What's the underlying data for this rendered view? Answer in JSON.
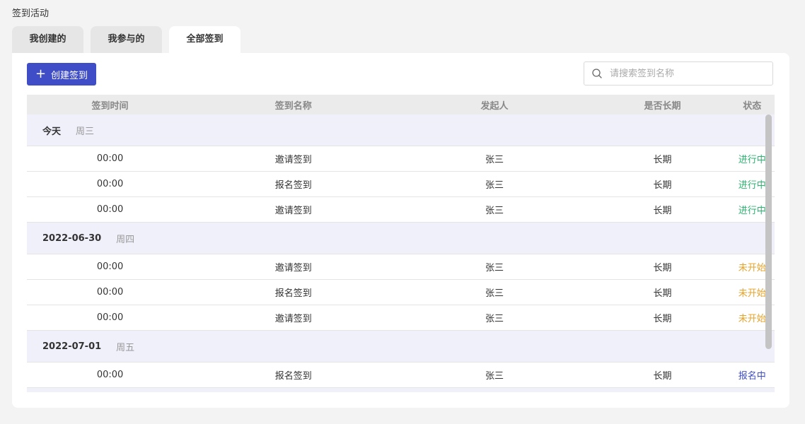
{
  "page_title": "签到活动",
  "tabs": [
    {
      "label": "我创建的",
      "active": false
    },
    {
      "label": "我参与的",
      "active": false
    },
    {
      "label": "全部签到",
      "active": true
    }
  ],
  "toolbar": {
    "create_label": "创建签到",
    "search_placeholder": "请搜索签到名称"
  },
  "colors": {
    "primary": "#3f4ec7",
    "status_in_progress": "#2bb36f",
    "status_not_started": "#e5a32a",
    "status_registering": "#3f4ec7"
  },
  "table": {
    "headers": [
      "签到时间",
      "签到名称",
      "发起人",
      "是否长期",
      "状态"
    ],
    "groups": [
      {
        "date": "今天",
        "weekday": "周三",
        "rows": [
          {
            "time": "00:00",
            "name": "邀请签到",
            "initiator": "张三",
            "long_term": "长期",
            "status": "进行中",
            "status_type": "in_progress"
          },
          {
            "time": "00:00",
            "name": "报名签到",
            "initiator": "张三",
            "long_term": "长期",
            "status": "进行中",
            "status_type": "in_progress"
          },
          {
            "time": "00:00",
            "name": "邀请签到",
            "initiator": "张三",
            "long_term": "长期",
            "status": "进行中",
            "status_type": "in_progress"
          }
        ]
      },
      {
        "date": "2022-06-30",
        "weekday": "周四",
        "rows": [
          {
            "time": "00:00",
            "name": "邀请签到",
            "initiator": "张三",
            "long_term": "长期",
            "status": "未开始",
            "status_type": "not_started"
          },
          {
            "time": "00:00",
            "name": "报名签到",
            "initiator": "张三",
            "long_term": "长期",
            "status": "未开始",
            "status_type": "not_started"
          },
          {
            "time": "00:00",
            "name": "邀请签到",
            "initiator": "张三",
            "long_term": "长期",
            "status": "未开始",
            "status_type": "not_started"
          }
        ]
      },
      {
        "date": "2022-07-01",
        "weekday": "周五",
        "rows": [
          {
            "time": "00:00",
            "name": "报名签到",
            "initiator": "张三",
            "long_term": "长期",
            "status": "报名中",
            "status_type": "registering"
          }
        ]
      }
    ]
  }
}
